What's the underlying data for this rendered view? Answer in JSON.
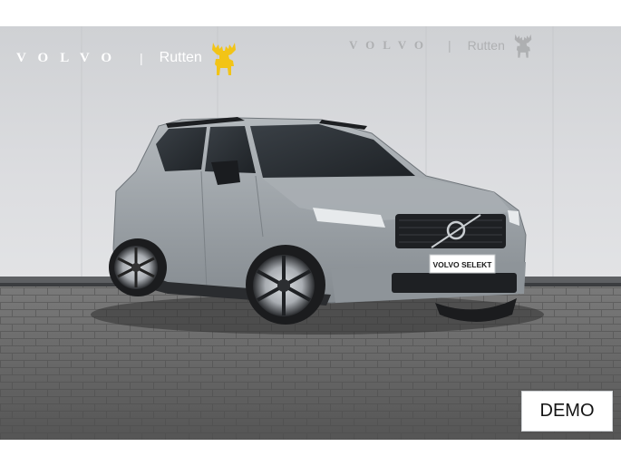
{
  "brand": {
    "maker": "VOLVO",
    "separator": "|",
    "dealer": "Rutten"
  },
  "watermark": {
    "maker": "VOLVO",
    "separator": "|",
    "dealer": "Rutten"
  },
  "car": {
    "plate_text": "VOLVO SELEKT"
  },
  "badge": {
    "label": "DEMO"
  },
  "colors": {
    "dealer_yellow": "#f2c417",
    "car_grey": "#9aa0a5",
    "wall": "#d8d9dc",
    "floor": "#6b6b6b",
    "text_white": "#ffffff"
  },
  "icons": {
    "brand_logo": "moose-icon",
    "watermark_logo": "moose-icon"
  }
}
